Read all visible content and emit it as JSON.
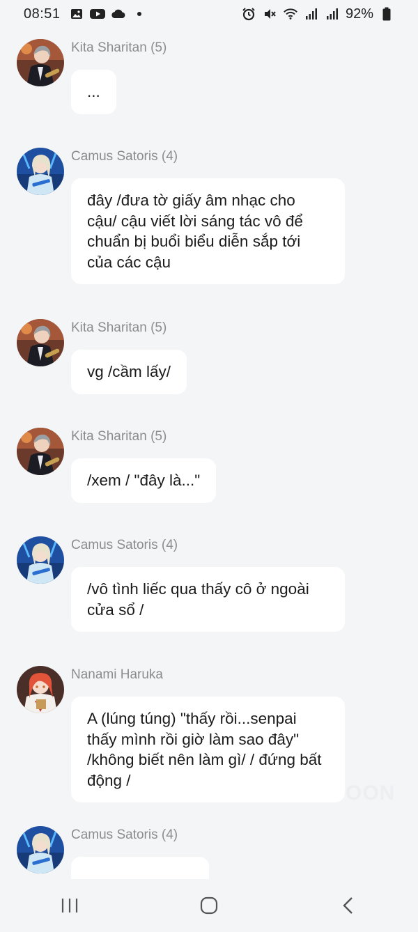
{
  "status_bar": {
    "time": "08:51",
    "battery": "92%",
    "left_icons": [
      "gallery-icon",
      "youtube-icon",
      "cloud-icon",
      "dot-icon"
    ],
    "right_icons": [
      "alarm-icon",
      "mute-icon",
      "wifi-icon",
      "signal-icon",
      "signal-icon",
      "battery-icon"
    ]
  },
  "messages": [
    {
      "sender": "Kita Sharitan (5)",
      "text": "...",
      "avatar": "kita"
    },
    {
      "sender": "Camus Satoris (4)",
      "text": "đây /đưa tờ giấy âm nhạc cho cậu/ cậu viết lời sáng tác vô để chuẩn bị buổi biểu diễn sắp tới của các cậu",
      "avatar": "camus"
    },
    {
      "sender": "Kita Sharitan (5)",
      "text": "vg /cầm lấy/",
      "avatar": "kita"
    },
    {
      "sender": "Kita Sharitan (5)",
      "text": "/xem / \"đây là...\"",
      "avatar": "kita"
    },
    {
      "sender": "Camus Satoris (4)",
      "text": "/vô tình liếc qua thấy cô ở ngoài cửa sổ /",
      "avatar": "camus"
    },
    {
      "sender": "Nanami Haruka",
      "text": "A (lúng túng) \"thấy rồi...senpai thấy mình rồi giờ làm sao đây\" /không biết nên làm gì/ / đứng bất động /",
      "avatar": "nanami"
    },
    {
      "sender": "Camus Satoris (4)",
      "text": "",
      "avatar": "camus"
    }
  ],
  "watermark": "OON",
  "nav": {
    "icons": [
      "recent-apps-icon",
      "home-icon",
      "back-icon"
    ]
  },
  "colors": {
    "background": "#f4f5f7",
    "bubble": "#ffffff",
    "sender": "#8c8c8c"
  }
}
